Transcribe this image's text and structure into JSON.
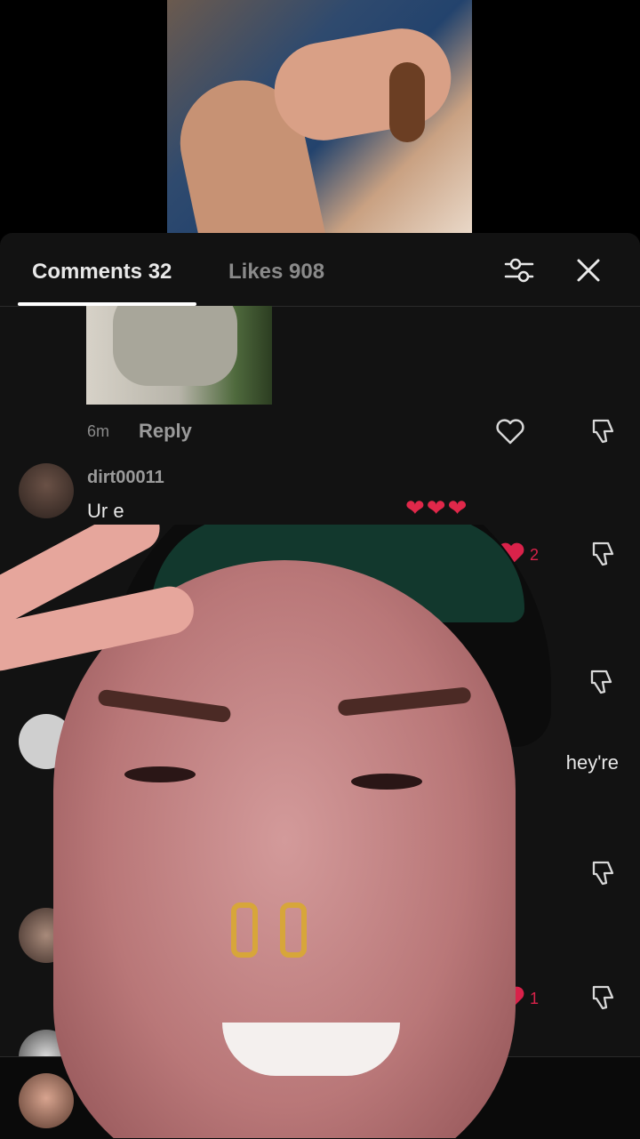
{
  "tabs": {
    "comments_label": "Comments 32",
    "likes_label": "Likes 908"
  },
  "comment_1": {
    "time": "6m",
    "reply_label": "Reply"
  },
  "comment_2": {
    "username": "dirt00011",
    "text_visible": "Ur e",
    "emoji": "❤❤❤",
    "like_count": "2"
  },
  "comment_3": {
    "text_partial": "hey're"
  },
  "comment_5": {
    "like_count": "1"
  },
  "colors": {
    "sheet_bg": "#121212",
    "accent_red": "#d9224a"
  },
  "icons": [
    "filter-icon",
    "close-icon",
    "heart-outline-icon",
    "heart-filled-icon",
    "dislike-icon"
  ]
}
